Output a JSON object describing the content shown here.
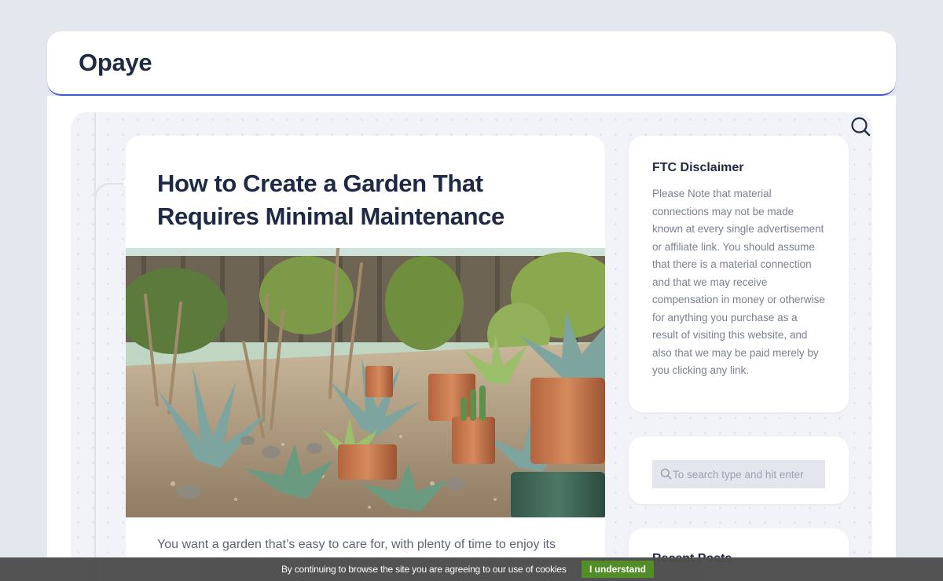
{
  "header": {
    "site_title": "Opaye"
  },
  "search_toggle": {
    "icon": "search-icon"
  },
  "post": {
    "title": "How to Create a Garden That Requires Minimal Maintenance",
    "image_icon": "garden-photo",
    "excerpt": "You want a garden that’s easy to care for, with plenty of time to enjoy its"
  },
  "sidebar": {
    "ftc": {
      "title": "FTC Disclaimer",
      "text": "Please Note that material connections may not be made known at every single advertisement or affiliate link. You should assume that there is a material connection and that we may receive compensation in money or otherwise for anything you purchase as a result of visiting this website, and also that we may be paid merely by you clicking any link."
    },
    "search": {
      "placeholder": "To search type and hit enter"
    },
    "recent": {
      "title": "Recent Posts"
    }
  },
  "cookie": {
    "text": "By continuing to browse the site you are agreeing to our use of cookies",
    "button_label": "I understand"
  },
  "colors": {
    "accent": "#3f5bd6",
    "title": "#1e2a45",
    "cookie_button": "#4e8a22"
  }
}
